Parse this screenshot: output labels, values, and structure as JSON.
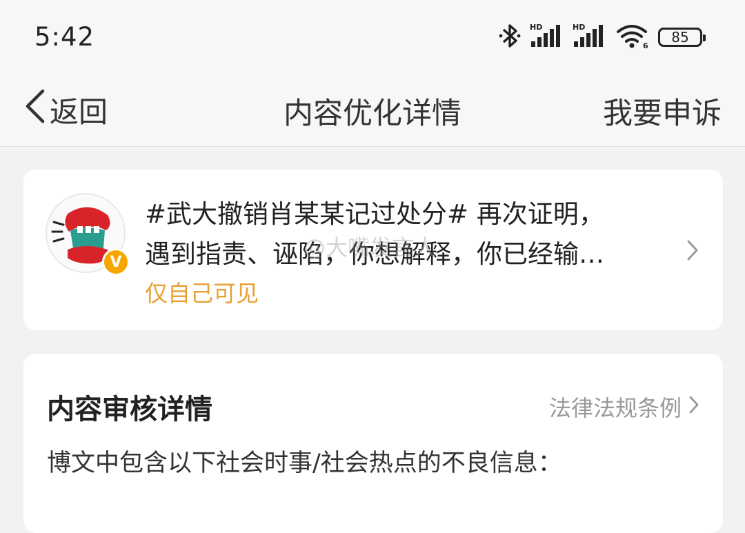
{
  "status_bar": {
    "time": "5:42",
    "battery": "85",
    "icons": [
      "bluetooth-icon",
      "signal-hd-icon",
      "signal-hd-icon",
      "wifi-icon",
      "battery-icon"
    ]
  },
  "nav": {
    "back_label": "返回",
    "title": "内容优化详情",
    "appeal_label": "我要申诉"
  },
  "post": {
    "line1": "#武大撤销肖某某记过处分# 再次证明，",
    "line2": "遇到指责、诬陷，你想解释，你已经输…",
    "visibility": "仅自己可见",
    "badge": "V"
  },
  "review": {
    "title": "内容审核详情",
    "law_link": "法律法规条例",
    "body": "博文中包含以下社会时事/社会热点的不良信息："
  },
  "watermark": "@大嘴发言人",
  "colors": {
    "accent_orange": "#e8a033",
    "badge_orange": "#f7a600",
    "muted_gray": "#999999"
  }
}
